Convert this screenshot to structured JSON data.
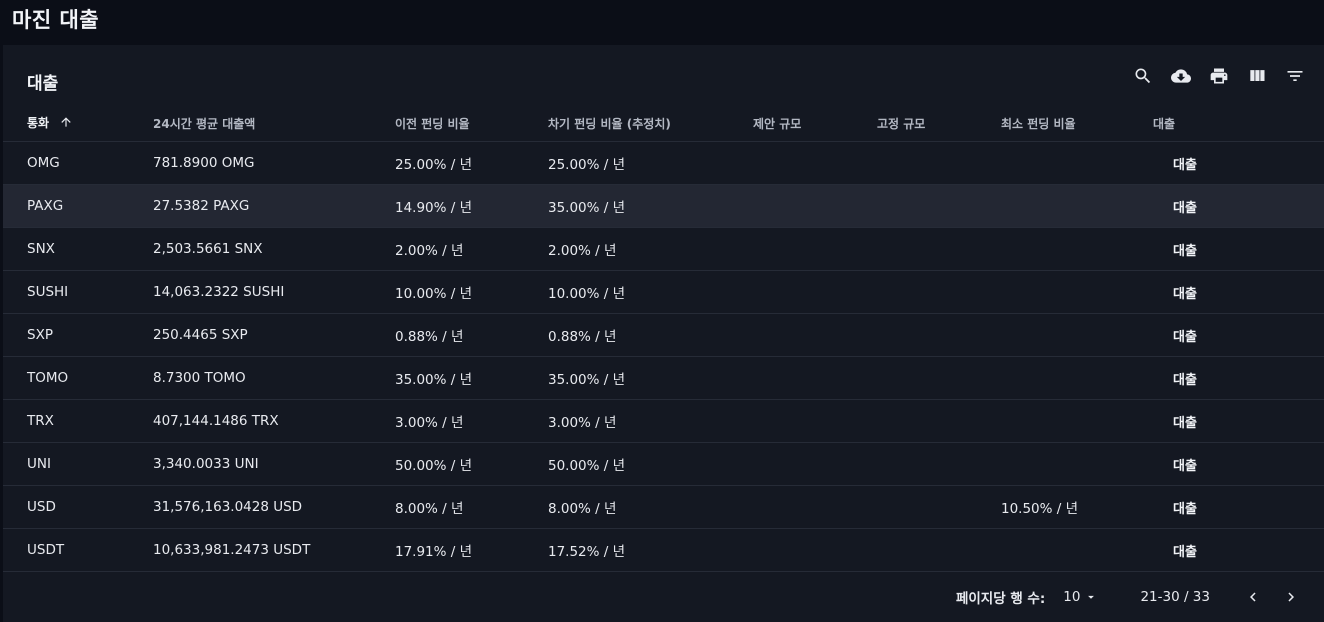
{
  "page": {
    "title": "마진 대출"
  },
  "panel": {
    "title": "대출",
    "toolbar": [
      {
        "name": "search-icon"
      },
      {
        "name": "download-icon"
      },
      {
        "name": "print-icon"
      },
      {
        "name": "view-columns-icon"
      },
      {
        "name": "filter-icon"
      }
    ]
  },
  "table": {
    "headers": [
      "통화",
      "24시간 평균 대출액",
      "이전 펀딩 비율",
      "차기 펀딩 비율 (추정치)",
      "제안 규모",
      "고정 규모",
      "최소 펀딩 비율",
      "대출"
    ],
    "sort": {
      "column": 0,
      "direction": "asc"
    },
    "action_label": "대출",
    "rows": [
      {
        "currency": "OMG",
        "avg_loan": "781.8900 OMG",
        "prev_rate": "25.00% / 년",
        "next_rate": "25.00% / 년",
        "offer_size": "",
        "fixed_size": "",
        "min_rate": ""
      },
      {
        "currency": "PAXG",
        "avg_loan": "27.5382 PAXG",
        "prev_rate": "14.90% / 년",
        "next_rate": "35.00% / 년",
        "offer_size": "",
        "fixed_size": "",
        "min_rate": ""
      },
      {
        "currency": "SNX",
        "avg_loan": "2,503.5661 SNX",
        "prev_rate": "2.00% / 년",
        "next_rate": "2.00% / 년",
        "offer_size": "",
        "fixed_size": "",
        "min_rate": ""
      },
      {
        "currency": "SUSHI",
        "avg_loan": "14,063.2322 SUSHI",
        "prev_rate": "10.00% / 년",
        "next_rate": "10.00% / 년",
        "offer_size": "",
        "fixed_size": "",
        "min_rate": ""
      },
      {
        "currency": "SXP",
        "avg_loan": "250.4465 SXP",
        "prev_rate": "0.88% / 년",
        "next_rate": "0.88% / 년",
        "offer_size": "",
        "fixed_size": "",
        "min_rate": ""
      },
      {
        "currency": "TOMO",
        "avg_loan": "8.7300 TOMO",
        "prev_rate": "35.00% / 년",
        "next_rate": "35.00% / 년",
        "offer_size": "",
        "fixed_size": "",
        "min_rate": ""
      },
      {
        "currency": "TRX",
        "avg_loan": "407,144.1486 TRX",
        "prev_rate": "3.00% / 년",
        "next_rate": "3.00% / 년",
        "offer_size": "",
        "fixed_size": "",
        "min_rate": ""
      },
      {
        "currency": "UNI",
        "avg_loan": "3,340.0033 UNI",
        "prev_rate": "50.00% / 년",
        "next_rate": "50.00% / 년",
        "offer_size": "",
        "fixed_size": "",
        "min_rate": ""
      },
      {
        "currency": "USD",
        "avg_loan": "31,576,163.0428 USD",
        "prev_rate": "8.00% / 년",
        "next_rate": "8.00% / 년",
        "offer_size": "",
        "fixed_size": "",
        "min_rate": "10.50% / 년"
      },
      {
        "currency": "USDT",
        "avg_loan": "10,633,981.2473 USDT",
        "prev_rate": "17.91% / 년",
        "next_rate": "17.52% / 년",
        "offer_size": "",
        "fixed_size": "",
        "min_rate": ""
      }
    ],
    "highlighted_row": 1
  },
  "footer": {
    "rows_per_page_label": "페이지당 행 수:",
    "rows_per_page": "10",
    "page_range": "21-30 / 33"
  },
  "colors": {
    "background": "#0b0e17",
    "panel": "#141822",
    "row_hover": "#232733",
    "divider": "#262b37"
  }
}
